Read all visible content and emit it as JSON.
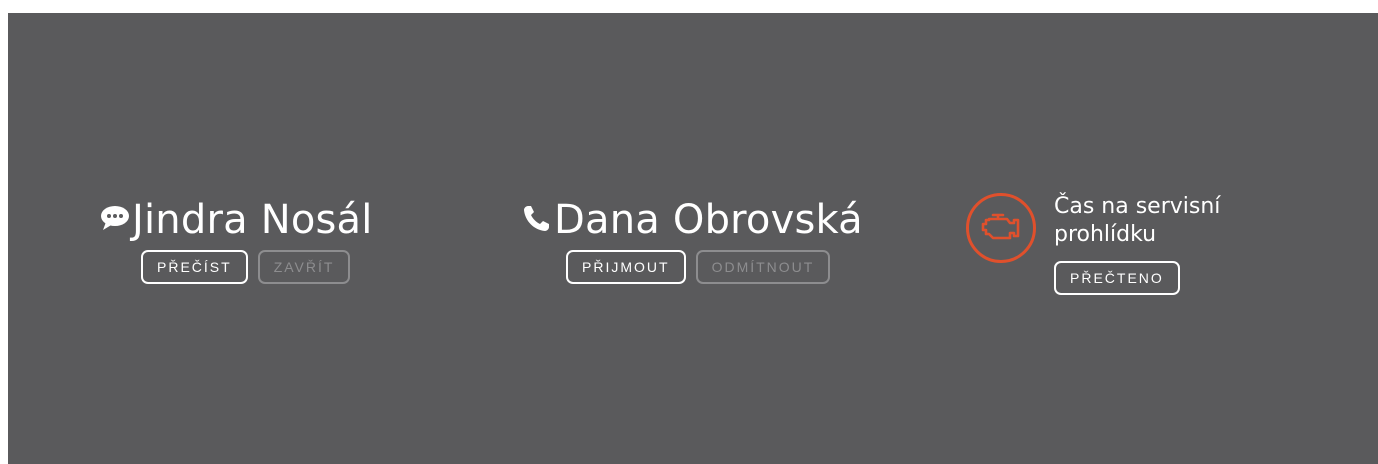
{
  "notifications": [
    {
      "type": "message",
      "icon": "chat-bubble-icon",
      "name": "Jindra Nosál",
      "actions": {
        "primary": "PŘEČÍST",
        "secondary": "ZAVŘÍT"
      }
    },
    {
      "type": "call",
      "icon": "phone-icon",
      "name": "Dana Obrovská",
      "actions": {
        "primary": "PŘIJMOUT",
        "secondary": "ODMÍTNOUT"
      }
    },
    {
      "type": "service",
      "icon": "engine-warning-icon",
      "message": "Čas na servisní prohlídku",
      "actions": {
        "primary": "PŘEČTENO"
      }
    }
  ],
  "colors": {
    "background": "#5a5a5c",
    "text": "#ffffff",
    "disabled": "#8d8d8f",
    "warning": "#e0502c"
  }
}
